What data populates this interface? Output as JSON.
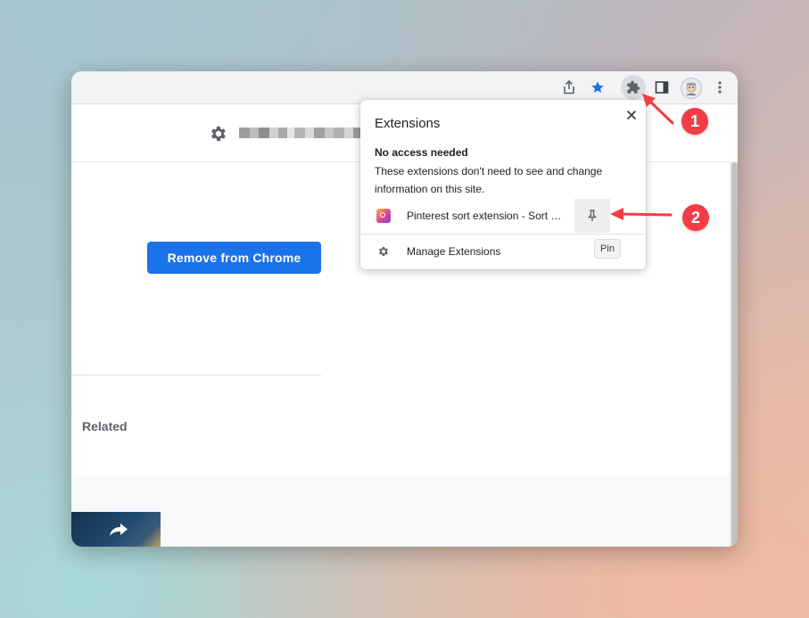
{
  "colors": {
    "accent_blue": "#1a73e8",
    "annotation_red": "#f43c46",
    "toolbar_bg": "#f1f3f4"
  },
  "toolbar": {
    "icons": [
      "share-icon",
      "bookmark-star-icon",
      "extensions-puzzle-icon",
      "side-panel-icon",
      "profile-avatar",
      "more-vert-icon"
    ]
  },
  "header": {
    "icon": "gear-icon",
    "title_pixelated": true
  },
  "main": {
    "remove_button_label": "Remove from Chrome",
    "related_heading": "Related"
  },
  "popup": {
    "title": "Extensions",
    "close_icon": "close-icon",
    "section_heading": "No access needed",
    "section_description": "These extensions don't need to see and change information on this site.",
    "extensions": [
      {
        "name": "Pinterest sort extension - Sort by popularity",
        "icon": "pinterest-sort-logo",
        "action_icon": "pin-icon"
      }
    ],
    "manage_label": "Manage Extensions",
    "manage_icon": "gear-icon"
  },
  "tooltip": {
    "text": "Pin"
  },
  "annotations": {
    "badge_1": "1",
    "badge_2": "2"
  }
}
